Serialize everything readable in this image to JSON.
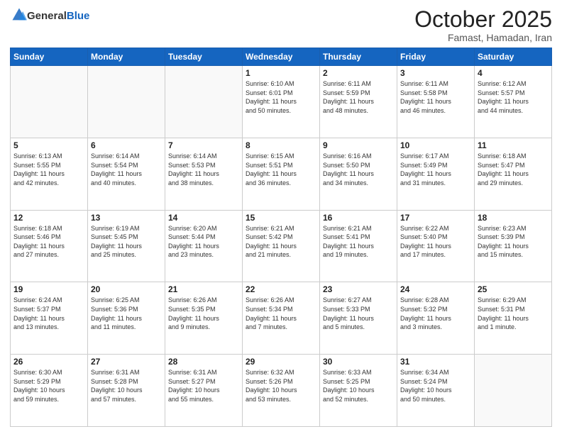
{
  "logo": {
    "general": "General",
    "blue": "Blue"
  },
  "header": {
    "month": "October 2025",
    "location": "Famast, Hamadan, Iran"
  },
  "weekdays": [
    "Sunday",
    "Monday",
    "Tuesday",
    "Wednesday",
    "Thursday",
    "Friday",
    "Saturday"
  ],
  "weeks": [
    [
      {
        "day": "",
        "info": ""
      },
      {
        "day": "",
        "info": ""
      },
      {
        "day": "",
        "info": ""
      },
      {
        "day": "1",
        "info": "Sunrise: 6:10 AM\nSunset: 6:01 PM\nDaylight: 11 hours\nand 50 minutes."
      },
      {
        "day": "2",
        "info": "Sunrise: 6:11 AM\nSunset: 5:59 PM\nDaylight: 11 hours\nand 48 minutes."
      },
      {
        "day": "3",
        "info": "Sunrise: 6:11 AM\nSunset: 5:58 PM\nDaylight: 11 hours\nand 46 minutes."
      },
      {
        "day": "4",
        "info": "Sunrise: 6:12 AM\nSunset: 5:57 PM\nDaylight: 11 hours\nand 44 minutes."
      }
    ],
    [
      {
        "day": "5",
        "info": "Sunrise: 6:13 AM\nSunset: 5:55 PM\nDaylight: 11 hours\nand 42 minutes."
      },
      {
        "day": "6",
        "info": "Sunrise: 6:14 AM\nSunset: 5:54 PM\nDaylight: 11 hours\nand 40 minutes."
      },
      {
        "day": "7",
        "info": "Sunrise: 6:14 AM\nSunset: 5:53 PM\nDaylight: 11 hours\nand 38 minutes."
      },
      {
        "day": "8",
        "info": "Sunrise: 6:15 AM\nSunset: 5:51 PM\nDaylight: 11 hours\nand 36 minutes."
      },
      {
        "day": "9",
        "info": "Sunrise: 6:16 AM\nSunset: 5:50 PM\nDaylight: 11 hours\nand 34 minutes."
      },
      {
        "day": "10",
        "info": "Sunrise: 6:17 AM\nSunset: 5:49 PM\nDaylight: 11 hours\nand 31 minutes."
      },
      {
        "day": "11",
        "info": "Sunrise: 6:18 AM\nSunset: 5:47 PM\nDaylight: 11 hours\nand 29 minutes."
      }
    ],
    [
      {
        "day": "12",
        "info": "Sunrise: 6:18 AM\nSunset: 5:46 PM\nDaylight: 11 hours\nand 27 minutes."
      },
      {
        "day": "13",
        "info": "Sunrise: 6:19 AM\nSunset: 5:45 PM\nDaylight: 11 hours\nand 25 minutes."
      },
      {
        "day": "14",
        "info": "Sunrise: 6:20 AM\nSunset: 5:44 PM\nDaylight: 11 hours\nand 23 minutes."
      },
      {
        "day": "15",
        "info": "Sunrise: 6:21 AM\nSunset: 5:42 PM\nDaylight: 11 hours\nand 21 minutes."
      },
      {
        "day": "16",
        "info": "Sunrise: 6:21 AM\nSunset: 5:41 PM\nDaylight: 11 hours\nand 19 minutes."
      },
      {
        "day": "17",
        "info": "Sunrise: 6:22 AM\nSunset: 5:40 PM\nDaylight: 11 hours\nand 17 minutes."
      },
      {
        "day": "18",
        "info": "Sunrise: 6:23 AM\nSunset: 5:39 PM\nDaylight: 11 hours\nand 15 minutes."
      }
    ],
    [
      {
        "day": "19",
        "info": "Sunrise: 6:24 AM\nSunset: 5:37 PM\nDaylight: 11 hours\nand 13 minutes."
      },
      {
        "day": "20",
        "info": "Sunrise: 6:25 AM\nSunset: 5:36 PM\nDaylight: 11 hours\nand 11 minutes."
      },
      {
        "day": "21",
        "info": "Sunrise: 6:26 AM\nSunset: 5:35 PM\nDaylight: 11 hours\nand 9 minutes."
      },
      {
        "day": "22",
        "info": "Sunrise: 6:26 AM\nSunset: 5:34 PM\nDaylight: 11 hours\nand 7 minutes."
      },
      {
        "day": "23",
        "info": "Sunrise: 6:27 AM\nSunset: 5:33 PM\nDaylight: 11 hours\nand 5 minutes."
      },
      {
        "day": "24",
        "info": "Sunrise: 6:28 AM\nSunset: 5:32 PM\nDaylight: 11 hours\nand 3 minutes."
      },
      {
        "day": "25",
        "info": "Sunrise: 6:29 AM\nSunset: 5:31 PM\nDaylight: 11 hours\nand 1 minute."
      }
    ],
    [
      {
        "day": "26",
        "info": "Sunrise: 6:30 AM\nSunset: 5:29 PM\nDaylight: 10 hours\nand 59 minutes."
      },
      {
        "day": "27",
        "info": "Sunrise: 6:31 AM\nSunset: 5:28 PM\nDaylight: 10 hours\nand 57 minutes."
      },
      {
        "day": "28",
        "info": "Sunrise: 6:31 AM\nSunset: 5:27 PM\nDaylight: 10 hours\nand 55 minutes."
      },
      {
        "day": "29",
        "info": "Sunrise: 6:32 AM\nSunset: 5:26 PM\nDaylight: 10 hours\nand 53 minutes."
      },
      {
        "day": "30",
        "info": "Sunrise: 6:33 AM\nSunset: 5:25 PM\nDaylight: 10 hours\nand 52 minutes."
      },
      {
        "day": "31",
        "info": "Sunrise: 6:34 AM\nSunset: 5:24 PM\nDaylight: 10 hours\nand 50 minutes."
      },
      {
        "day": "",
        "info": ""
      }
    ]
  ]
}
